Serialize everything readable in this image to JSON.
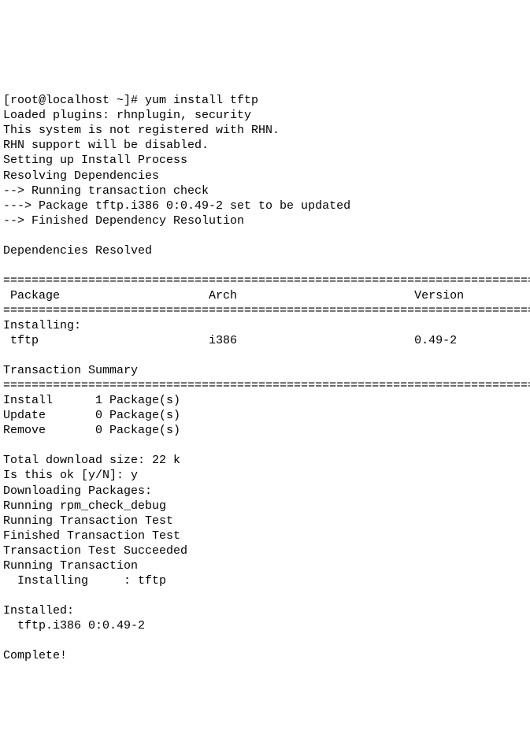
{
  "prompt": {
    "full": "[root@localhost ~]# yum install tftp"
  },
  "preamble": {
    "l1": "Loaded plugins: rhnplugin, security",
    "l2": "This system is not registered with RHN.",
    "l3": "RHN support will be disabled.",
    "l4": "Setting up Install Process",
    "l5": "Resolving Dependencies",
    "l6": "--> Running transaction check",
    "l7": "---> Package tftp.i386 0:0.49-2 set to be updated",
    "l8": "--> Finished Dependency Resolution"
  },
  "deps_header": "Dependencies Resolved",
  "hr": "=============================================================================",
  "table": {
    "header": " Package                     Arch                         Version",
    "section": "Installing:",
    "row": " tftp                        i386                         0.49-2"
  },
  "txn": {
    "title": "Transaction Summary",
    "install": "Install      1 Package(s)",
    "update": "Update       0 Package(s)",
    "remove": "Remove       0 Package(s)"
  },
  "download": {
    "size": "Total download size: 22 k",
    "confirm": "Is this ok [y/N]: y",
    "l1": "Downloading Packages:",
    "l2": "Running rpm_check_debug",
    "l3": "Running Transaction Test",
    "l4": "Finished Transaction Test",
    "l5": "Transaction Test Succeeded",
    "l6": "Running Transaction",
    "l7": "  Installing     : tftp"
  },
  "installed": {
    "header": "Installed:",
    "pkg": "  tftp.i386 0:0.49-2"
  },
  "complete": "Complete!"
}
